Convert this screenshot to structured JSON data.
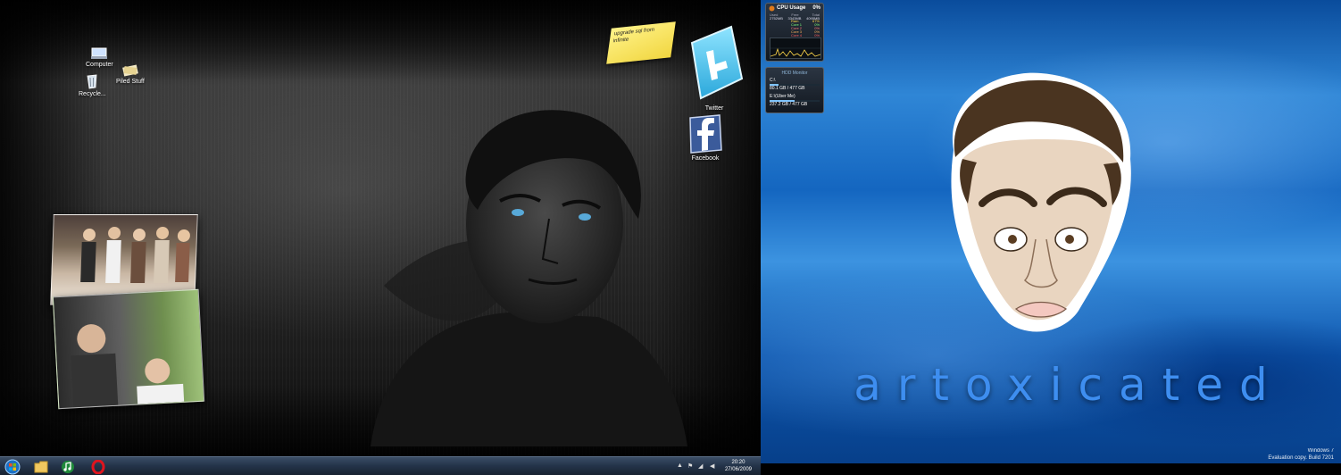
{
  "left_desktop": {
    "icons": [
      {
        "name": "computer",
        "label": "Computer"
      },
      {
        "name": "piled-stuff",
        "label": "Piled Stuff"
      },
      {
        "name": "recycle-bin",
        "label": "Recycle..."
      }
    ],
    "social": [
      {
        "name": "twitter",
        "label": "Twitter"
      },
      {
        "name": "facebook",
        "label": "Facebook"
      }
    ],
    "sticky_note": "upgrade sql from infinite"
  },
  "taskbar": {
    "clock_time": "20:20",
    "clock_date": "27/06/2009",
    "pinned": [
      "start",
      "explorer",
      "media-player",
      "opera"
    ]
  },
  "gadgets": {
    "cpu": {
      "title": "CPU Usage",
      "percent": "0%",
      "headers": [
        "Used",
        "Free",
        "Total"
      ],
      "values": [
        "2752MB",
        "3343MB",
        "4095MB"
      ],
      "rows": [
        {
          "label": "Ram",
          "value": "67%"
        },
        {
          "label": "Core 1",
          "value": "0%"
        },
        {
          "label": "Core 2",
          "value": "0%"
        },
        {
          "label": "Core 3",
          "value": "0%"
        },
        {
          "label": "Core 4",
          "value": "0%"
        }
      ]
    },
    "hdd": {
      "title": "HDD Monitor",
      "drives": [
        {
          "name": "C:\\",
          "usage": "80.1 GB / 477 GB",
          "fill": 0.17
        },
        {
          "name": "E:\\(Uber Me)",
          "usage": "237.2 GB / 477 GB",
          "fill": 0.5
        }
      ]
    }
  },
  "right_desktop": {
    "brand": "artoxicated",
    "watermark_line1": "Windows 7",
    "watermark_line2": "Evaluation copy. Build 7201"
  },
  "colors": {
    "brand_blue": "#3e8ef0",
    "taskbar": "#24344a"
  }
}
